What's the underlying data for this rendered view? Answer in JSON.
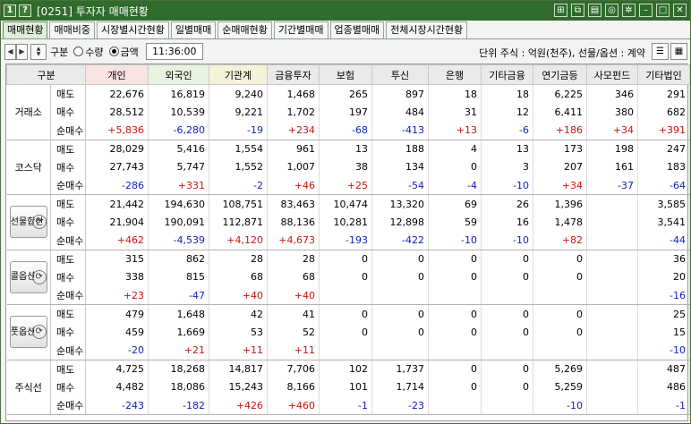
{
  "window": {
    "badge1": "1",
    "badge2": "?",
    "title": "[0251] 투자자 매매현황"
  },
  "tabs": [
    "매매현황",
    "매매비중",
    "시장별시간현황",
    "일별매매",
    "순매매현황",
    "기간별매매",
    "업종별매매",
    "전체시장시간현황"
  ],
  "toolbar": {
    "gubun_label": "구분",
    "radio1": "수량",
    "radio2": "금액",
    "time": "11:36:00",
    "unit": "단위 주식 : 억원(천주), 선물/옵션 : 계약"
  },
  "columns": [
    "구분",
    "개인",
    "외국인",
    "기관계",
    "금융투자",
    "보험",
    "투신",
    "은행",
    "기타금융",
    "연기금등",
    "사모펀드",
    "기타법인"
  ],
  "groups": [
    {
      "name": "거래소",
      "button": false,
      "rows": [
        {
          "label": "매도",
          "values": [
            "22,676",
            "16,819",
            "9,240",
            "1,468",
            "265",
            "897",
            "18",
            "18",
            "6,225",
            "346",
            "291"
          ]
        },
        {
          "label": "매수",
          "values": [
            "28,512",
            "10,539",
            "9,221",
            "1,702",
            "197",
            "484",
            "31",
            "12",
            "6,411",
            "380",
            "682"
          ]
        },
        {
          "label": "순매수",
          "values": [
            "+5,836",
            "-6,280",
            "-19",
            "+234",
            "-68",
            "-413",
            "+13",
            "-6",
            "+186",
            "+34",
            "+391"
          ]
        }
      ]
    },
    {
      "name": "코스닥",
      "button": false,
      "rows": [
        {
          "label": "매도",
          "values": [
            "28,029",
            "5,416",
            "1,554",
            "961",
            "13",
            "188",
            "4",
            "13",
            "173",
            "198",
            "247"
          ]
        },
        {
          "label": "매수",
          "values": [
            "27,743",
            "5,747",
            "1,552",
            "1,007",
            "38",
            "134",
            "0",
            "3",
            "207",
            "161",
            "183"
          ]
        },
        {
          "label": "순매수",
          "values": [
            "-286",
            "+331",
            "-2",
            "+46",
            "+25",
            "-54",
            "-4",
            "-10",
            "+34",
            "-37",
            "-64"
          ]
        }
      ]
    },
    {
      "name": "선물합산",
      "button": true,
      "rows": [
        {
          "label": "매도",
          "values": [
            "21,442",
            "194,630",
            "108,751",
            "83,463",
            "10,474",
            "13,320",
            "69",
            "26",
            "1,396",
            "",
            "3,585"
          ]
        },
        {
          "label": "매수",
          "values": [
            "21,904",
            "190,091",
            "112,871",
            "88,136",
            "10,281",
            "12,898",
            "59",
            "16",
            "1,478",
            "",
            "3,541"
          ]
        },
        {
          "label": "순매수",
          "values": [
            "+462",
            "-4,539",
            "+4,120",
            "+4,673",
            "-193",
            "-422",
            "-10",
            "-10",
            "+82",
            "",
            "-44"
          ]
        }
      ]
    },
    {
      "name": "콜옵션",
      "button": true,
      "rows": [
        {
          "label": "매도",
          "values": [
            "315",
            "862",
            "28",
            "28",
            "0",
            "0",
            "0",
            "0",
            "0",
            "",
            "36"
          ]
        },
        {
          "label": "매수",
          "values": [
            "338",
            "815",
            "68",
            "68",
            "0",
            "0",
            "0",
            "0",
            "0",
            "",
            "20"
          ]
        },
        {
          "label": "순매수",
          "values": [
            "+23",
            "-47",
            "+40",
            "+40",
            "",
            "",
            "",
            "",
            "",
            "",
            "-16"
          ]
        }
      ]
    },
    {
      "name": "풋옵션",
      "button": true,
      "rows": [
        {
          "label": "매도",
          "values": [
            "479",
            "1,648",
            "42",
            "41",
            "0",
            "0",
            "0",
            "0",
            "0",
            "",
            "25"
          ]
        },
        {
          "label": "매수",
          "values": [
            "459",
            "1,669",
            "53",
            "52",
            "0",
            "0",
            "0",
            "0",
            "0",
            "",
            "15"
          ]
        },
        {
          "label": "순매수",
          "values": [
            "-20",
            "+21",
            "+11",
            "+11",
            "",
            "",
            "",
            "",
            "",
            "",
            "-10"
          ]
        }
      ]
    },
    {
      "name": "주식선",
      "button": false,
      "rows": [
        {
          "label": "매도",
          "values": [
            "4,725",
            "18,268",
            "14,817",
            "7,706",
            "102",
            "1,737",
            "0",
            "0",
            "5,269",
            "",
            "487"
          ]
        },
        {
          "label": "매수",
          "values": [
            "4,482",
            "18,086",
            "15,243",
            "8,166",
            "101",
            "1,714",
            "0",
            "0",
            "5,259",
            "",
            "486"
          ]
        },
        {
          "label": "순매수",
          "values": [
            "-243",
            "-182",
            "+426",
            "+460",
            "-1",
            "-23",
            "",
            "",
            "-10",
            "",
            "-1"
          ]
        }
      ]
    }
  ],
  "colors": {
    "positive": "#d01010",
    "negative": "#1020c0",
    "titlebar": "#2f6b2c"
  }
}
